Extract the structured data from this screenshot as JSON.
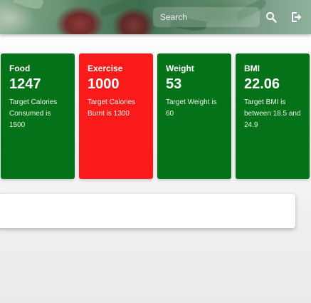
{
  "header": {
    "search_placeholder": "Search",
    "search_icon": "search-icon",
    "logout_icon": "logout-icon"
  },
  "colors": {
    "green": "#047219",
    "red": "#fb1b1b"
  },
  "cards": [
    {
      "label": "Food",
      "value": "1247",
      "description": "Target Calories Consumed is 1500",
      "color": "#047219"
    },
    {
      "label": "Exercise",
      "value": "1000",
      "description": "Target Calories Burnt is 1300",
      "color": "#fb1b1b"
    },
    {
      "label": "Weight",
      "value": "53",
      "description": "Target Weight is 60",
      "color": "#047219"
    },
    {
      "label": "BMI",
      "value": "22.06",
      "description": "Target BMI is between 18.5 and 24.9",
      "color": "#047219"
    }
  ]
}
